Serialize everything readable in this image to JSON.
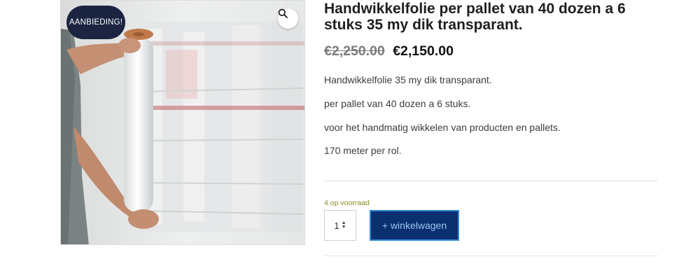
{
  "gallery": {
    "badge_text": "AANBIEDING!",
    "zoom_icon": "magnifier-icon"
  },
  "product": {
    "title": "Handwikkelfolie per pallet van 40 dozen a 6 stuks 35 my dik transparant.",
    "old_price": "€2,250.00",
    "new_price": "€2,150.00",
    "description": [
      "Handwikkelfolie 35 my dik transparant.",
      "per pallet van 40 dozen a 6 stuks.",
      "voor het handmatig wikkelen van producten en pallets.",
      "170 meter per rol."
    ]
  },
  "cart": {
    "stock_text": "4 op voorraad",
    "quantity": "1",
    "add_label": "+ winkelwagen"
  },
  "colors": {
    "badge_bg": "#1b2440",
    "button_bg": "#0b2f6f",
    "button_border": "#2e88d8",
    "stock_text": "#8a8a20"
  }
}
